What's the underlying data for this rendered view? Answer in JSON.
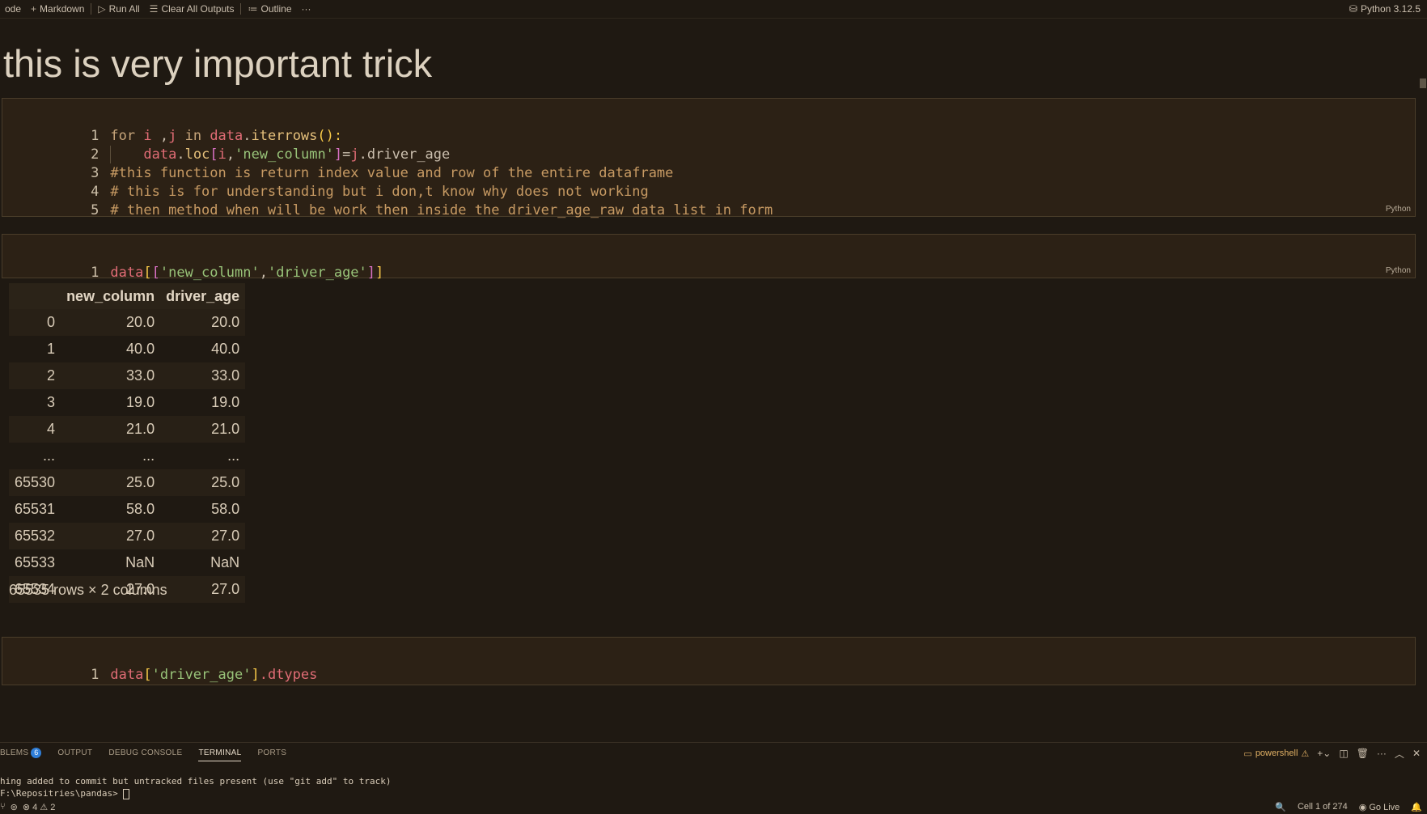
{
  "toolbar": {
    "code_label": "ode",
    "markdown_label": "Markdown",
    "run_all_label": "Run All",
    "clear_outputs_label": "Clear All Outputs",
    "outline_label": "Outline",
    "more_label": "···",
    "kernel_label": "Python 3.12.5"
  },
  "heading": "this is very important trick",
  "cell1": {
    "lang": "Python",
    "lines": [
      {
        "n": "1",
        "t1": "for",
        "t2": " i ",
        "t3": ",",
        "t4": "j",
        "t5": " in ",
        "t6": "data",
        "t7": ".",
        "t8": "iterrows",
        "t9": "():",
        "t10": ""
      },
      {
        "n": "2",
        "c1": "data",
        "c2": ".",
        "c3": "loc",
        "c4": "[",
        "c5": "i",
        "c6": ",",
        "c7": "'new_column'",
        "c8": "]",
        "c9": "=",
        "c10": "j",
        "c11": ".driver_age"
      },
      {
        "n": "3",
        "comment": "#this function is return index value and row of the entire dataframe"
      },
      {
        "n": "4",
        "comment": "# this is for understanding but i don,t know why does not working"
      },
      {
        "n": "5",
        "comment": "# then method when will be work then inside the driver_age_raw data list in form"
      }
    ]
  },
  "cell2": {
    "lang": "Python",
    "n": "1",
    "p1": "data",
    "p2": "[",
    "p3": "[",
    "p4": "'new_column'",
    "p5": ",",
    "p6": "'driver_age'",
    "p7": "]",
    "p8": "]"
  },
  "dataframe": {
    "columns": [
      "",
      "new_column",
      "driver_age"
    ],
    "rows": [
      [
        "0",
        "20.0",
        "20.0"
      ],
      [
        "1",
        "40.0",
        "40.0"
      ],
      [
        "2",
        "33.0",
        "33.0"
      ],
      [
        "3",
        "19.0",
        "19.0"
      ],
      [
        "4",
        "21.0",
        "21.0"
      ],
      [
        "...",
        "...",
        "..."
      ],
      [
        "65530",
        "25.0",
        "25.0"
      ],
      [
        "65531",
        "58.0",
        "58.0"
      ],
      [
        "65532",
        "27.0",
        "27.0"
      ],
      [
        "65533",
        "NaN",
        "NaN"
      ],
      [
        "65534",
        "27.0",
        "27.0"
      ]
    ],
    "shape": "65535 rows × 2 columns"
  },
  "cell3": {
    "n": "1",
    "p1": "data",
    "p2": "[",
    "p3": "'driver_age'",
    "p4": "]",
    "p5": ".dtypes"
  },
  "panel": {
    "tabs": [
      "BLEMS",
      "OUTPUT",
      "DEBUG CONSOLE",
      "TERMINAL",
      "PORTS"
    ],
    "problems_count": "6",
    "shell": "powershell",
    "terminal_line1": "hing added to commit but untracked files present (use \"git add\" to track)",
    "terminal_line2": "F:\\Repositries\\pandas> "
  },
  "status": {
    "errors": "4",
    "warnings": "2",
    "cell_pos": "Cell 1 of 274",
    "go_live": "Go Live"
  },
  "colors": {
    "background": "#1f1912",
    "cell_bg": "#2c2115",
    "accent": "#2f7ed8"
  }
}
